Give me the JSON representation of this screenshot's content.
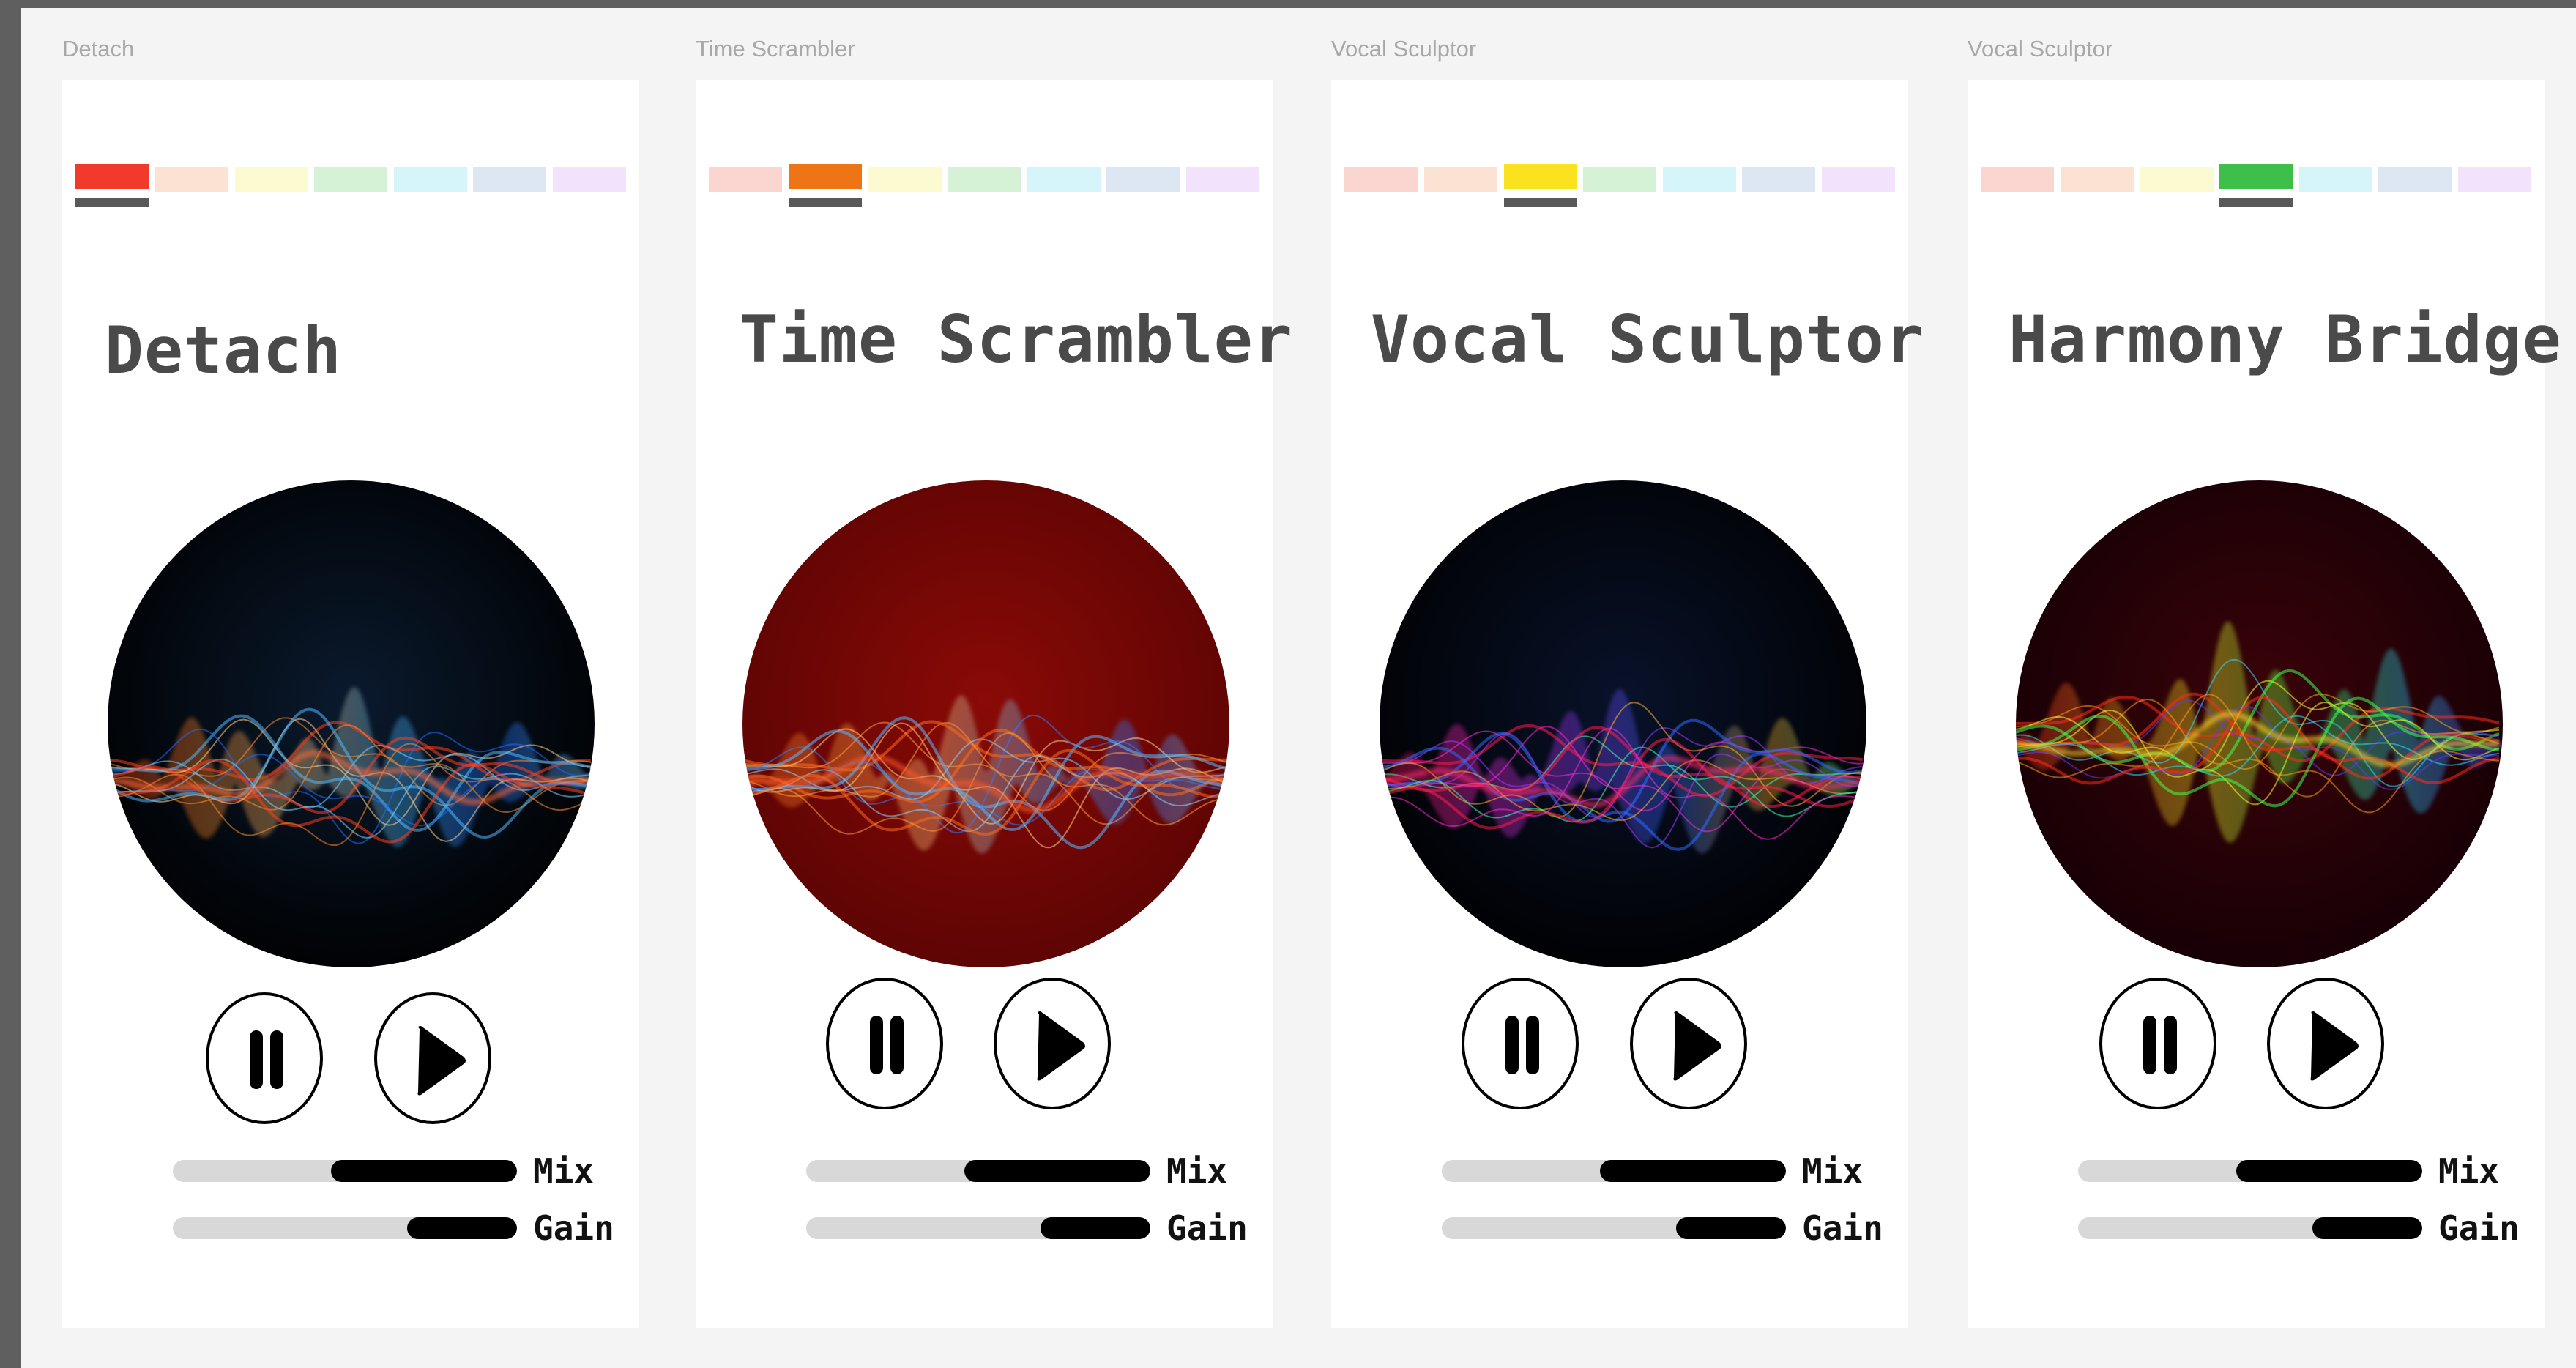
{
  "frames": [
    {
      "label": "Detach",
      "title": "Detach",
      "active_color_index": 0,
      "disc_theme": "dark-spectral",
      "controls": {
        "pause_icon": "pause-icon",
        "play_icon": "play-icon"
      },
      "sliders": [
        {
          "label": "Mix",
          "level": 0.54
        },
        {
          "label": "Gain",
          "level": 0.32
        }
      ]
    },
    {
      "label": "Time Scrambler",
      "title": "Time Scrambler",
      "active_color_index": 1,
      "disc_theme": "red-spectral",
      "controls": {
        "pause_icon": "pause-icon",
        "play_icon": "play-icon"
      },
      "sliders": [
        {
          "label": "Mix",
          "level": 0.54
        },
        {
          "label": "Gain",
          "level": 0.32
        }
      ]
    },
    {
      "label": "Vocal Sculptor",
      "title": "Vocal Sculptor",
      "active_color_index": 2,
      "disc_theme": "neon-spectral",
      "controls": {
        "pause_icon": "pause-icon",
        "play_icon": "play-icon"
      },
      "sliders": [
        {
          "label": "Mix",
          "level": 0.54
        },
        {
          "label": "Gain",
          "level": 0.32
        }
      ]
    },
    {
      "label": "Vocal Sculptor",
      "title": "Harmony Bridge",
      "active_color_index": 3,
      "disc_theme": "rainbow-spectral",
      "controls": {
        "pause_icon": "pause-icon",
        "play_icon": "play-icon"
      },
      "sliders": [
        {
          "label": "Mix",
          "level": 0.54
        },
        {
          "label": "Gain",
          "level": 0.32
        }
      ]
    }
  ],
  "palette": {
    "active": [
      "#f13a2b",
      "#ee7516",
      "#fbe21f",
      "#3ebf49"
    ],
    "inactive": [
      "#fbd6d1",
      "#fbe2d3",
      "#fbfad1",
      "#d6f2d6",
      "#d6f5fb",
      "#dde7f3",
      "#f2e2fb"
    ]
  },
  "colors": {
    "canvas": "#f4f4f4",
    "artboard": "#ffffff",
    "title": "#4a4a4a",
    "slider_track": "#d8d8d8",
    "slider_fill": "#000000"
  }
}
